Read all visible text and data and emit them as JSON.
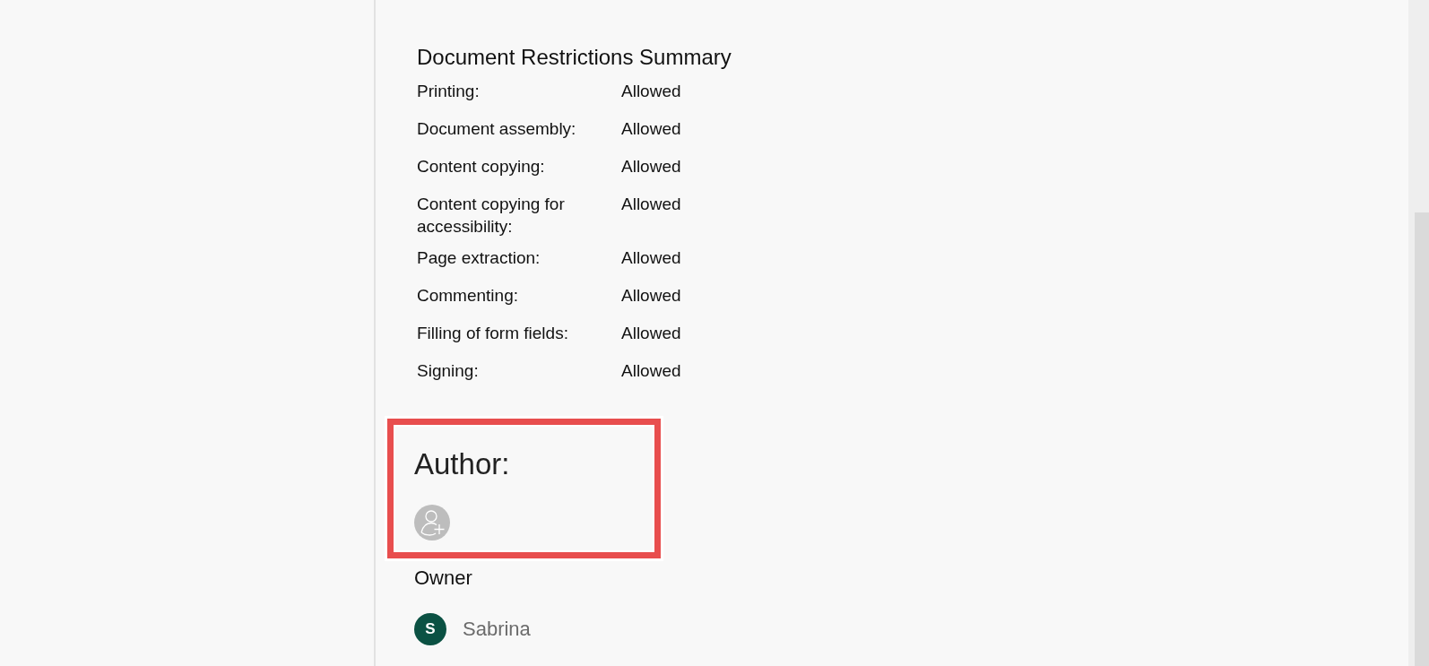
{
  "restrictions": {
    "title": "Document Restrictions Summary",
    "rows": [
      {
        "label": "Printing:",
        "value": "Allowed"
      },
      {
        "label": "Document assembly:",
        "value": "Allowed"
      },
      {
        "label": "Content copying:",
        "value": "Allowed"
      },
      {
        "label": "Content copying for accessibility:",
        "value": "Allowed"
      },
      {
        "label": "Page extraction:",
        "value": "Allowed"
      },
      {
        "label": "Commenting:",
        "value": "Allowed"
      },
      {
        "label": "Filling of form fields:",
        "value": "Allowed"
      },
      {
        "label": "Signing:",
        "value": "Allowed"
      }
    ]
  },
  "author": {
    "label": "Author:",
    "highlighted": true
  },
  "owner": {
    "label": "Owner",
    "people": [
      {
        "initial": "S",
        "name": "Sabrina",
        "color": "#0b5143"
      }
    ]
  }
}
